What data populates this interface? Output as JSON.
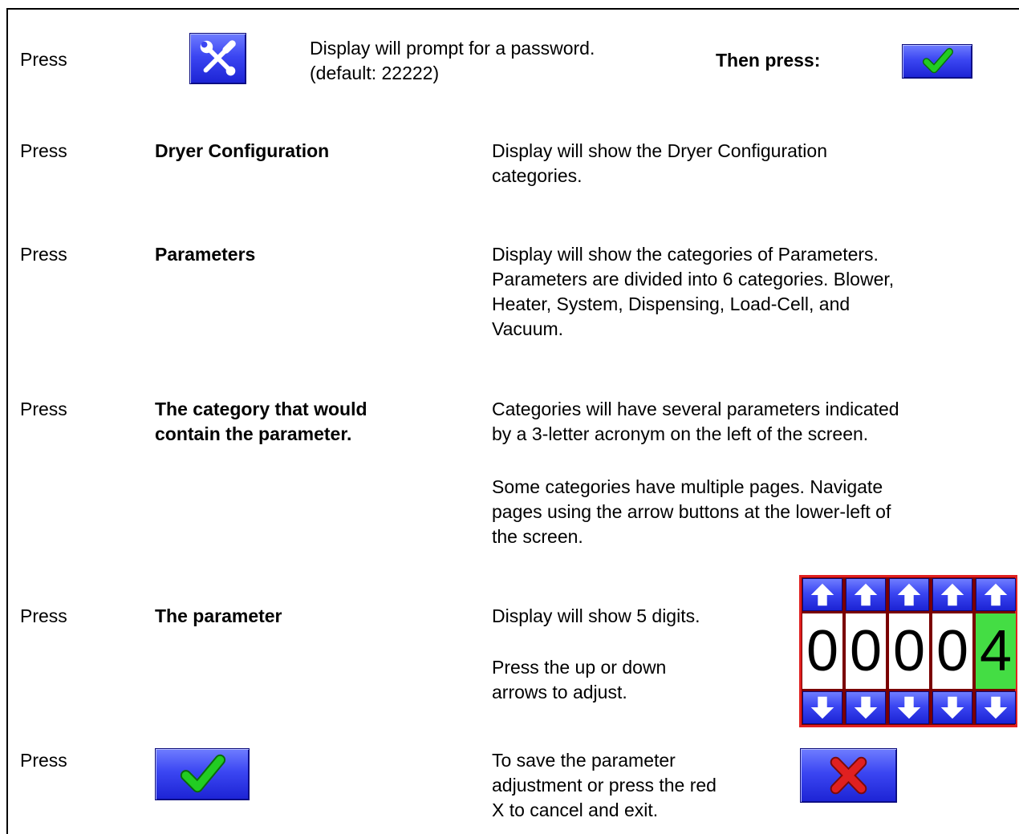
{
  "steps": [
    {
      "press": "Press",
      "target": "",
      "desc": [
        "Display will prompt for a password.",
        "(default: 22222)"
      ],
      "then": "Then press:"
    },
    {
      "press": "Press",
      "target": [
        "Dryer Configuration"
      ],
      "desc": [
        "Display will show the Dryer Configuration",
        "categories."
      ]
    },
    {
      "press": "Press",
      "target": [
        "Parameters"
      ],
      "desc": [
        "Display will show the categories of Parameters.",
        "Parameters are divided into 6 categories.  Blower,",
        "Heater, System, Dispensing, Load-Cell, and",
        "Vacuum."
      ]
    },
    {
      "press": "Press",
      "target": [
        "The category that would",
        "contain the parameter."
      ],
      "desc": [
        "Categories will have several parameters indicated",
        "by a 3-letter acronym on the left of the screen."
      ],
      "desc2": [
        "Some categories have multiple pages.  Navigate",
        "pages using the arrow buttons at the lower-left of",
        "the screen."
      ]
    },
    {
      "press": "Press",
      "target": [
        "The parameter"
      ],
      "desc": [
        "Display will show 5 digits."
      ],
      "desc2": [
        "Press the up or down",
        "arrows to adjust."
      ]
    },
    {
      "press": "Press",
      "target": "",
      "desc": [
        "To save the parameter",
        "adjustment or press the red",
        "X to cancel and exit."
      ]
    }
  ],
  "icons": {
    "tools": "tools-icon",
    "check": "checkmark-icon",
    "cancel": "red-x-icon",
    "up": "up-arrow-icon",
    "down": "down-arrow-icon"
  },
  "digit_display": {
    "digits": [
      "0",
      "0",
      "0",
      "0",
      "4"
    ],
    "active_index": 4
  },
  "colors": {
    "button_blue": "#3b46f2",
    "check_green": "#22cc22",
    "cancel_red": "#e02020",
    "active_digit": "#44dd44"
  }
}
